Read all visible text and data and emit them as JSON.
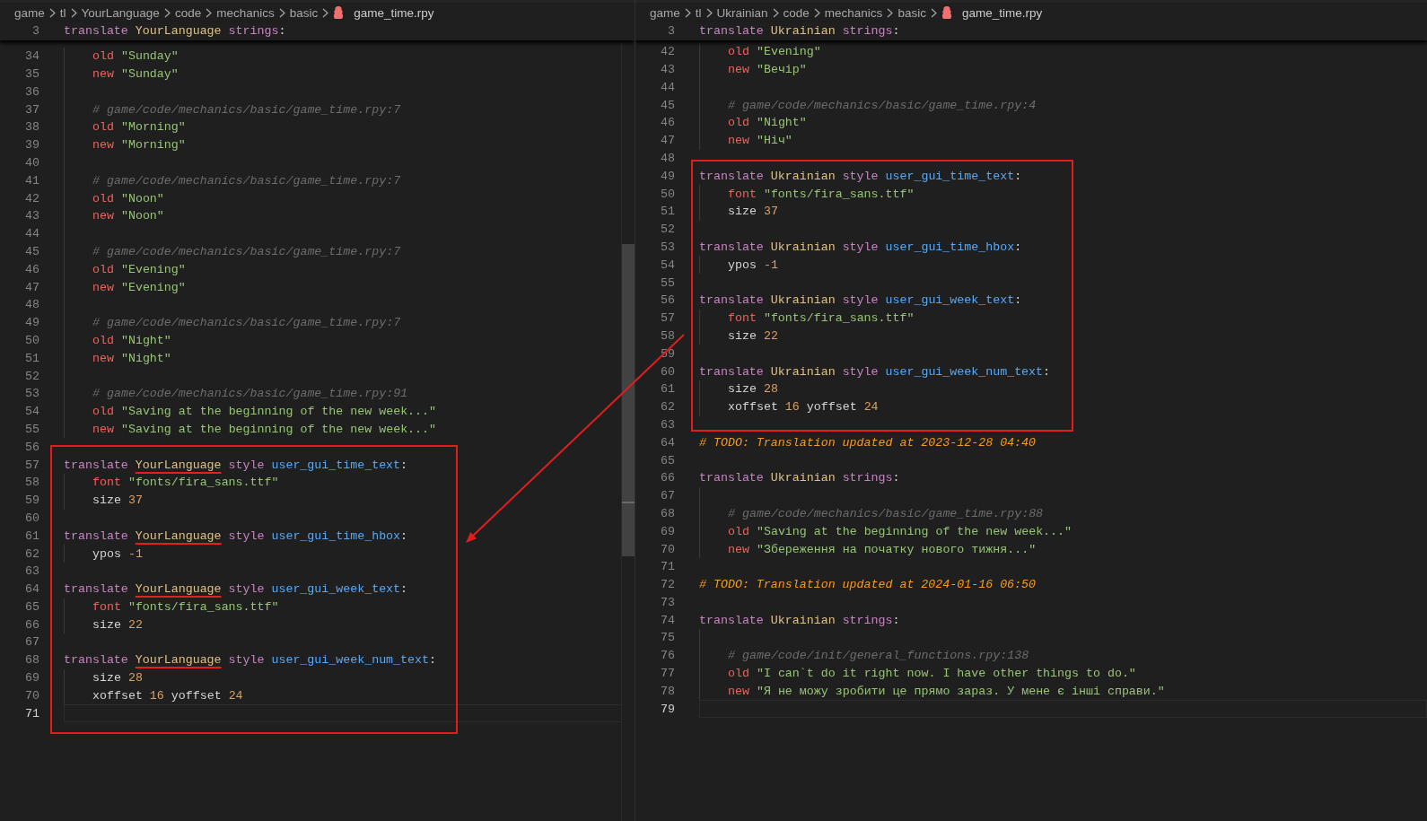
{
  "panes": [
    {
      "breadcrumb": [
        "game",
        "tl",
        "YourLanguage",
        "code",
        "mechanics",
        "basic"
      ],
      "file": "game_time.rpy",
      "sticky": {
        "number": "3",
        "tokens": [
          {
            "kind": "keyword",
            "text": "translate"
          },
          {
            "kind": "language",
            "text": "YourLanguage"
          },
          {
            "kind": "keyword",
            "text": "strings"
          },
          {
            "kind": "punctuation",
            "text": ":"
          }
        ]
      },
      "lines": [
        {
          "number": "34",
          "kind": "body",
          "current": false,
          "tokens": [
            {
              "kind": "property",
              "text": "old"
            },
            {
              "kind": "string",
              "text": "\"Sunday\""
            }
          ]
        },
        {
          "number": "35",
          "kind": "body",
          "current": false,
          "tokens": [
            {
              "kind": "property",
              "text": "new"
            },
            {
              "kind": "string",
              "text": "\"Sunday\""
            }
          ]
        },
        {
          "number": "36",
          "kind": "gap",
          "current": false
        },
        {
          "number": "37",
          "kind": "body",
          "current": false,
          "tokens": [
            {
              "kind": "comment",
              "text": "# game/code/mechanics/basic/game_time.rpy:7"
            }
          ]
        },
        {
          "number": "38",
          "kind": "body",
          "current": false,
          "tokens": [
            {
              "kind": "property",
              "text": "old"
            },
            {
              "kind": "string",
              "text": "\"Morning\""
            }
          ]
        },
        {
          "number": "39",
          "kind": "body",
          "current": false,
          "tokens": [
            {
              "kind": "property",
              "text": "new"
            },
            {
              "kind": "string",
              "text": "\"Morning\""
            }
          ]
        },
        {
          "number": "40",
          "kind": "gap",
          "current": false
        },
        {
          "number": "41",
          "kind": "body",
          "current": false,
          "tokens": [
            {
              "kind": "comment",
              "text": "# game/code/mechanics/basic/game_time.rpy:7"
            }
          ]
        },
        {
          "number": "42",
          "kind": "body",
          "current": false,
          "tokens": [
            {
              "kind": "property",
              "text": "old"
            },
            {
              "kind": "string",
              "text": "\"Noon\""
            }
          ]
        },
        {
          "number": "43",
          "kind": "body",
          "current": false,
          "tokens": [
            {
              "kind": "property",
              "text": "new"
            },
            {
              "kind": "string",
              "text": "\"Noon\""
            }
          ]
        },
        {
          "number": "44",
          "kind": "gap",
          "current": false
        },
        {
          "number": "45",
          "kind": "body",
          "current": false,
          "tokens": [
            {
              "kind": "comment",
              "text": "# game/code/mechanics/basic/game_time.rpy:7"
            }
          ]
        },
        {
          "number": "46",
          "kind": "body",
          "current": false,
          "tokens": [
            {
              "kind": "property",
              "text": "old"
            },
            {
              "kind": "string",
              "text": "\"Evening\""
            }
          ]
        },
        {
          "number": "47",
          "kind": "body",
          "current": false,
          "tokens": [
            {
              "kind": "property",
              "text": "new"
            },
            {
              "kind": "string",
              "text": "\"Evening\""
            }
          ]
        },
        {
          "number": "48",
          "kind": "gap",
          "current": false
        },
        {
          "number": "49",
          "kind": "body",
          "current": false,
          "tokens": [
            {
              "kind": "comment",
              "text": "# game/code/mechanics/basic/game_time.rpy:7"
            }
          ]
        },
        {
          "number": "50",
          "kind": "body",
          "current": false,
          "tokens": [
            {
              "kind": "property",
              "text": "old"
            },
            {
              "kind": "string",
              "text": "\"Night\""
            }
          ]
        },
        {
          "number": "51",
          "kind": "body",
          "current": false,
          "tokens": [
            {
              "kind": "property",
              "text": "new"
            },
            {
              "kind": "string",
              "text": "\"Night\""
            }
          ]
        },
        {
          "number": "52",
          "kind": "gap",
          "current": false
        },
        {
          "number": "53",
          "kind": "body",
          "current": false,
          "tokens": [
            {
              "kind": "comment",
              "text": "# game/code/mechanics/basic/game_time.rpy:91"
            }
          ]
        },
        {
          "number": "54",
          "kind": "body",
          "current": false,
          "tokens": [
            {
              "kind": "property",
              "text": "old"
            },
            {
              "kind": "string",
              "text": "\"Saving at the beginning of the new week...\""
            }
          ]
        },
        {
          "number": "55",
          "kind": "body",
          "current": false,
          "tokens": [
            {
              "kind": "property",
              "text": "new"
            },
            {
              "kind": "string",
              "text": "\"Saving at the beginning of the new week...\""
            }
          ]
        },
        {
          "number": "56",
          "kind": "blank",
          "current": false
        },
        {
          "number": "57",
          "kind": "top",
          "current": false,
          "tokens": [
            {
              "kind": "keyword",
              "text": "translate"
            },
            {
              "kind": "language-marked",
              "text": "YourLanguage"
            },
            {
              "kind": "keyword",
              "text": "style"
            },
            {
              "kind": "name",
              "text": "user_gui_time_text"
            },
            {
              "kind": "punctuation",
              "text": ":"
            }
          ]
        },
        {
          "number": "58",
          "kind": "body",
          "current": false,
          "tokens": [
            {
              "kind": "property",
              "text": "font"
            },
            {
              "kind": "string",
              "text": "\"fonts/fira_sans.ttf\""
            }
          ]
        },
        {
          "number": "59",
          "kind": "body",
          "current": false,
          "tokens": [
            {
              "kind": "plain",
              "text": "size"
            },
            {
              "kind": "number",
              "text": "37"
            }
          ]
        },
        {
          "number": "60",
          "kind": "blank",
          "current": false
        },
        {
          "number": "61",
          "kind": "top",
          "current": false,
          "tokens": [
            {
              "kind": "keyword",
              "text": "translate"
            },
            {
              "kind": "language-marked",
              "text": "YourLanguage"
            },
            {
              "kind": "keyword",
              "text": "style"
            },
            {
              "kind": "name",
              "text": "user_gui_time_hbox"
            },
            {
              "kind": "punctuation",
              "text": ":"
            }
          ]
        },
        {
          "number": "62",
          "kind": "body",
          "current": false,
          "tokens": [
            {
              "kind": "plain",
              "text": "ypos"
            },
            {
              "kind": "number",
              "text": "-1"
            }
          ]
        },
        {
          "number": "63",
          "kind": "blank",
          "current": false
        },
        {
          "number": "64",
          "kind": "top",
          "current": false,
          "tokens": [
            {
              "kind": "keyword",
              "text": "translate"
            },
            {
              "kind": "language-marked",
              "text": "YourLanguage"
            },
            {
              "kind": "keyword",
              "text": "style"
            },
            {
              "kind": "name",
              "text": "user_gui_week_text"
            },
            {
              "kind": "punctuation",
              "text": ":"
            }
          ]
        },
        {
          "number": "65",
          "kind": "body",
          "current": false,
          "tokens": [
            {
              "kind": "property",
              "text": "font"
            },
            {
              "kind": "string",
              "text": "\"fonts/fira_sans.ttf\""
            }
          ]
        },
        {
          "number": "66",
          "kind": "body",
          "current": false,
          "tokens": [
            {
              "kind": "plain",
              "text": "size"
            },
            {
              "kind": "number",
              "text": "22"
            }
          ]
        },
        {
          "number": "67",
          "kind": "blank",
          "current": false
        },
        {
          "number": "68",
          "kind": "top",
          "current": false,
          "tokens": [
            {
              "kind": "keyword",
              "text": "translate"
            },
            {
              "kind": "language-marked",
              "text": "YourLanguage"
            },
            {
              "kind": "keyword",
              "text": "style"
            },
            {
              "kind": "name",
              "text": "user_gui_week_num_text"
            },
            {
              "kind": "punctuation",
              "text": ":"
            }
          ]
        },
        {
          "number": "69",
          "kind": "body",
          "current": false,
          "tokens": [
            {
              "kind": "plain",
              "text": "size"
            },
            {
              "kind": "number",
              "text": "28"
            }
          ]
        },
        {
          "number": "70",
          "kind": "body",
          "current": false,
          "tokens": [
            {
              "kind": "plain",
              "text": "xoffset"
            },
            {
              "kind": "number",
              "text": "16"
            },
            {
              "kind": "plain",
              "text": "yoffset"
            },
            {
              "kind": "number",
              "text": "24"
            }
          ]
        },
        {
          "number": "71",
          "kind": "blank",
          "current": true
        }
      ]
    },
    {
      "breadcrumb": [
        "game",
        "tl",
        "Ukrainian",
        "code",
        "mechanics",
        "basic"
      ],
      "file": "game_time.rpy",
      "sticky": {
        "number": "3",
        "tokens": [
          {
            "kind": "keyword",
            "text": "translate"
          },
          {
            "kind": "language",
            "text": "Ukrainian"
          },
          {
            "kind": "keyword",
            "text": "strings"
          },
          {
            "kind": "punctuation",
            "text": ":"
          }
        ]
      },
      "lines": [
        {
          "number": "42",
          "kind": "body",
          "current": false,
          "tokens": [
            {
              "kind": "property",
              "text": "old"
            },
            {
              "kind": "string",
              "text": "\"Evening\""
            }
          ]
        },
        {
          "number": "43",
          "kind": "body",
          "current": false,
          "tokens": [
            {
              "kind": "property",
              "text": "new"
            },
            {
              "kind": "string",
              "text": "\"Вечір\""
            }
          ]
        },
        {
          "number": "44",
          "kind": "gap",
          "current": false
        },
        {
          "number": "45",
          "kind": "body",
          "current": false,
          "tokens": [
            {
              "kind": "comment",
              "text": "# game/code/mechanics/basic/game_time.rpy:4"
            }
          ]
        },
        {
          "number": "46",
          "kind": "body",
          "current": false,
          "tokens": [
            {
              "kind": "property",
              "text": "old"
            },
            {
              "kind": "string",
              "text": "\"Night\""
            }
          ]
        },
        {
          "number": "47",
          "kind": "body",
          "current": false,
          "tokens": [
            {
              "kind": "property",
              "text": "new"
            },
            {
              "kind": "string",
              "text": "\"Ніч\""
            }
          ]
        },
        {
          "number": "48",
          "kind": "blank",
          "current": false
        },
        {
          "number": "49",
          "kind": "top",
          "current": false,
          "tokens": [
            {
              "kind": "keyword",
              "text": "translate"
            },
            {
              "kind": "language",
              "text": "Ukrainian"
            },
            {
              "kind": "keyword",
              "text": "style"
            },
            {
              "kind": "name",
              "text": "user_gui_time_text"
            },
            {
              "kind": "punctuation",
              "text": ":"
            }
          ]
        },
        {
          "number": "50",
          "kind": "body",
          "current": false,
          "tokens": [
            {
              "kind": "property",
              "text": "font"
            },
            {
              "kind": "string",
              "text": "\"fonts/fira_sans.ttf\""
            }
          ]
        },
        {
          "number": "51",
          "kind": "body",
          "current": false,
          "tokens": [
            {
              "kind": "plain",
              "text": "size"
            },
            {
              "kind": "number",
              "text": "37"
            }
          ]
        },
        {
          "number": "52",
          "kind": "blank",
          "current": false
        },
        {
          "number": "53",
          "kind": "top",
          "current": false,
          "tokens": [
            {
              "kind": "keyword",
              "text": "translate"
            },
            {
              "kind": "language",
              "text": "Ukrainian"
            },
            {
              "kind": "keyword",
              "text": "style"
            },
            {
              "kind": "name",
              "text": "user_gui_time_hbox"
            },
            {
              "kind": "punctuation",
              "text": ":"
            }
          ]
        },
        {
          "number": "54",
          "kind": "body",
          "current": false,
          "tokens": [
            {
              "kind": "plain",
              "text": "ypos"
            },
            {
              "kind": "number",
              "text": "-1"
            }
          ]
        },
        {
          "number": "55",
          "kind": "blank",
          "current": false
        },
        {
          "number": "56",
          "kind": "top",
          "current": false,
          "tokens": [
            {
              "kind": "keyword",
              "text": "translate"
            },
            {
              "kind": "language",
              "text": "Ukrainian"
            },
            {
              "kind": "keyword",
              "text": "style"
            },
            {
              "kind": "name",
              "text": "user_gui_week_text"
            },
            {
              "kind": "punctuation",
              "text": ":"
            }
          ]
        },
        {
          "number": "57",
          "kind": "body",
          "current": false,
          "tokens": [
            {
              "kind": "property",
              "text": "font"
            },
            {
              "kind": "string",
              "text": "\"fonts/fira_sans.ttf\""
            }
          ]
        },
        {
          "number": "58",
          "kind": "body",
          "current": false,
          "tokens": [
            {
              "kind": "plain",
              "text": "size"
            },
            {
              "kind": "number",
              "text": "22"
            }
          ]
        },
        {
          "number": "59",
          "kind": "blank",
          "current": false
        },
        {
          "number": "60",
          "kind": "top",
          "current": false,
          "tokens": [
            {
              "kind": "keyword",
              "text": "translate"
            },
            {
              "kind": "language",
              "text": "Ukrainian"
            },
            {
              "kind": "keyword",
              "text": "style"
            },
            {
              "kind": "name",
              "text": "user_gui_week_num_text"
            },
            {
              "kind": "punctuation",
              "text": ":"
            }
          ]
        },
        {
          "number": "61",
          "kind": "body",
          "current": false,
          "tokens": [
            {
              "kind": "plain",
              "text": "size"
            },
            {
              "kind": "number",
              "text": "28"
            }
          ]
        },
        {
          "number": "62",
          "kind": "body",
          "current": false,
          "tokens": [
            {
              "kind": "plain",
              "text": "xoffset"
            },
            {
              "kind": "number",
              "text": "16"
            },
            {
              "kind": "plain",
              "text": "yoffset"
            },
            {
              "kind": "number",
              "text": "24"
            }
          ]
        },
        {
          "number": "63",
          "kind": "blank",
          "current": false
        },
        {
          "number": "64",
          "kind": "top",
          "current": false,
          "tokens": [
            {
              "kind": "todo",
              "text": "# TODO: Translation updated at 2023-12-28 04:40"
            }
          ]
        },
        {
          "number": "65",
          "kind": "blank",
          "current": false
        },
        {
          "number": "66",
          "kind": "top",
          "current": false,
          "tokens": [
            {
              "kind": "keyword",
              "text": "translate"
            },
            {
              "kind": "language",
              "text": "Ukrainian"
            },
            {
              "kind": "keyword",
              "text": "strings"
            },
            {
              "kind": "punctuation",
              "text": ":"
            }
          ]
        },
        {
          "number": "67",
          "kind": "gap",
          "current": false
        },
        {
          "number": "68",
          "kind": "body",
          "current": false,
          "tokens": [
            {
              "kind": "comment",
              "text": "# game/code/mechanics/basic/game_time.rpy:88"
            }
          ]
        },
        {
          "number": "69",
          "kind": "body",
          "current": false,
          "tokens": [
            {
              "kind": "property",
              "text": "old"
            },
            {
              "kind": "string",
              "text": "\"Saving at the beginning of the new week...\""
            }
          ]
        },
        {
          "number": "70",
          "kind": "body",
          "current": false,
          "tokens": [
            {
              "kind": "property",
              "text": "new"
            },
            {
              "kind": "string",
              "text": "\"Збереження на початку нового тижня...\""
            }
          ]
        },
        {
          "number": "71",
          "kind": "blank",
          "current": false
        },
        {
          "number": "72",
          "kind": "top",
          "current": false,
          "tokens": [
            {
              "kind": "todo",
              "text": "# TODO: Translation updated at 2024-01-16 06:50"
            }
          ]
        },
        {
          "number": "73",
          "kind": "blank",
          "current": false
        },
        {
          "number": "74",
          "kind": "top",
          "current": false,
          "tokens": [
            {
              "kind": "keyword",
              "text": "translate"
            },
            {
              "kind": "language",
              "text": "Ukrainian"
            },
            {
              "kind": "keyword",
              "text": "strings"
            },
            {
              "kind": "punctuation",
              "text": ":"
            }
          ]
        },
        {
          "number": "75",
          "kind": "gap",
          "current": false
        },
        {
          "number": "76",
          "kind": "body",
          "current": false,
          "tokens": [
            {
              "kind": "comment",
              "text": "# game/code/init/general_functions.rpy:138"
            }
          ]
        },
        {
          "number": "77",
          "kind": "body",
          "current": false,
          "tokens": [
            {
              "kind": "property",
              "text": "old"
            },
            {
              "kind": "string",
              "text": "\"I can`t do it right now. I have other things to do.\""
            }
          ]
        },
        {
          "number": "78",
          "kind": "body",
          "current": false,
          "tokens": [
            {
              "kind": "property",
              "text": "new"
            },
            {
              "kind": "string",
              "text": "\"Я не можу зробити це прямо зараз. У мене є інші справи.\""
            }
          ]
        },
        {
          "number": "79",
          "kind": "blank",
          "current": true
        }
      ]
    }
  ]
}
